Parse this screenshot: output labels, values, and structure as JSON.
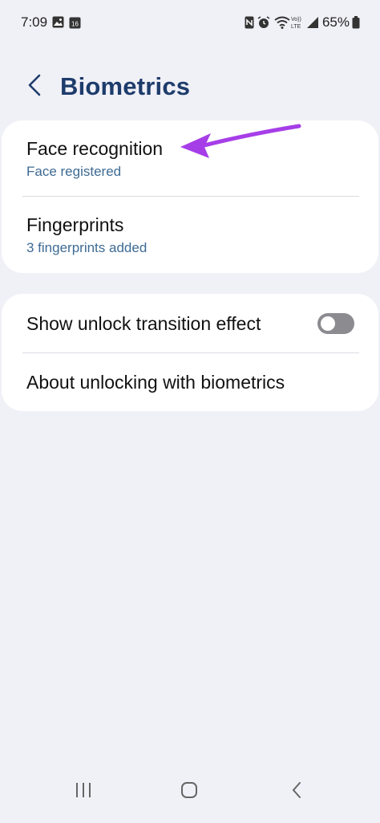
{
  "status_bar": {
    "time": "7:09",
    "battery_percent": "65%",
    "left_icons": [
      "gallery-icon",
      "calendar-icon"
    ],
    "calendar_day": "16",
    "right_icons": [
      "nfc-icon",
      "alarm-icon",
      "wifi-icon",
      "volte-icon",
      "signal-icon",
      "battery-icon"
    ],
    "volte_top": "Vo))",
    "volte_bottom": "LTE"
  },
  "header": {
    "title": "Biometrics"
  },
  "biometrics_card": {
    "face": {
      "title": "Face recognition",
      "subtitle": "Face registered"
    },
    "fingerprints": {
      "title": "Fingerprints",
      "subtitle": "3 fingerprints added"
    }
  },
  "options_card": {
    "unlock_transition": {
      "title": "Show unlock transition effect",
      "toggle_on": false
    },
    "about": {
      "title": "About unlocking with biometrics"
    }
  },
  "colors": {
    "background": "#f0f0f7",
    "title": "#1d3c6b",
    "subtitle": "#3e6b94",
    "annotation_arrow": "#a63ee8",
    "toggle_off": "#8b8b90"
  },
  "nav_bar": {
    "icons": [
      "recents-icon",
      "home-icon",
      "back-nav-icon"
    ]
  }
}
